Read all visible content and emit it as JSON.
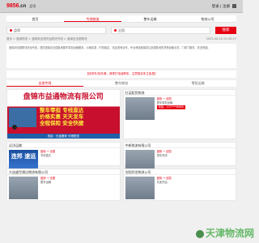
{
  "topbar": {
    "logo": "9856",
    "logo_tld": ".cn",
    "city": "盘锦",
    "login": "登录 | 注册"
  },
  "nav": [
    "首页",
    "专线物流",
    "整车运输",
    "物流公司"
  ],
  "search": {
    "from_placeholder": "盘锦",
    "to_placeholder": "全国",
    "button": "搜索"
  },
  "breadcrumb": {
    "path": "首页 > 盘锦物流 > 盘锦到全国货运物流专线 > 盘锦至全国物流",
    "date": "2025-06-10 02:45:27"
  },
  "description": "盘锦到全国物流货运专线，提供盘锦至全国各地整车零担运输服务，价格实惠，时效稳定，欢迎咨询合作。专业承接盘锦发往全国各地的货物运输业务，门到门服务，安全快捷。",
  "notice": "【找货车/找车源，请拨打电话联系，注意核实车主信息】",
  "tabs": [
    "全部专线",
    "整车物流",
    "零担运输"
  ],
  "cards": [
    {
      "type": "banner",
      "banner_title": "盘锦市益通物流有限公司",
      "slogans": [
        "整车零担  专线直达",
        "价格实惠  天天发车",
        "全程保险  安全快捷"
      ],
      "stripe": "电话：长途搬家  仓储配送"
    },
    {
      "type": "list",
      "title": "红运配货物流",
      "thumb": "",
      "lines": [
        "盘锦 → 全国",
        "整车零担运输",
        "电话：137****6688"
      ]
    },
    {
      "type": "list",
      "title": "远洋运输",
      "thumb": "连邦\n速运",
      "lines": [
        "盘锦 → 全国",
        "专线直达",
        "门到门服务"
      ]
    },
    {
      "type": "list",
      "title": "中新物流有限公司",
      "thumb": "",
      "lines": [
        "盘锦 → 全国",
        "零担专线",
        "价格优惠"
      ]
    },
    {
      "type": "list",
      "title": "大连盛世通达物流有限公司",
      "thumb": "",
      "lines": [
        "盘锦 → 全国",
        "整车运输",
        "欢迎来电"
      ]
    },
    {
      "type": "list",
      "title": "沈阳欣龙物流公司",
      "thumb": "",
      "lines": [
        "盘锦 → 全国",
        "长途货运",
        "价格实惠"
      ]
    }
  ],
  "watermark": "天津物流网"
}
